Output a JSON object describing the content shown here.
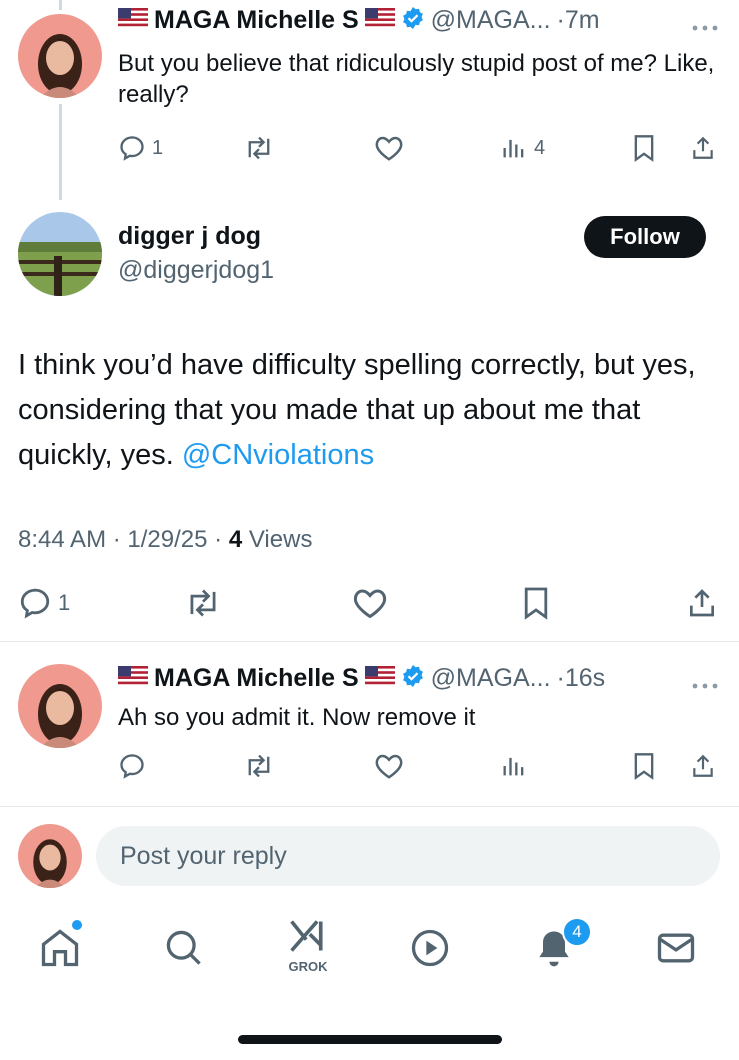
{
  "tweet1": {
    "name": "MAGA Michelle S",
    "handle": "@MAGA...",
    "time": "·7m",
    "text": "But you believe that ridiculously stupid post of me?  Like, really?",
    "replies": "1",
    "views": "4"
  },
  "main": {
    "name": "digger j dog",
    "handle": "@diggerjdog1",
    "follow_label": "Follow",
    "text": "I think you’d have difficulty spelling correctly, but yes, considering that you made that up about me that quickly, yes. ",
    "mention": "@CNviolations",
    "time": "8:44 AM",
    "date": "1/29/25",
    "views_count": "4",
    "views_label": "Views",
    "replies": "1"
  },
  "tweet2": {
    "name": "MAGA Michelle S",
    "handle": "@MAGA...",
    "time": "·16s",
    "text": "Ah so you admit it. Now remove it"
  },
  "reply": {
    "placeholder": "Post your reply"
  },
  "nav": {
    "grok_label": "GROK",
    "notifications_count": "4"
  },
  "colors": {
    "accent": "#1d9bf0",
    "text": "#0f1419",
    "secondary": "#536471"
  }
}
